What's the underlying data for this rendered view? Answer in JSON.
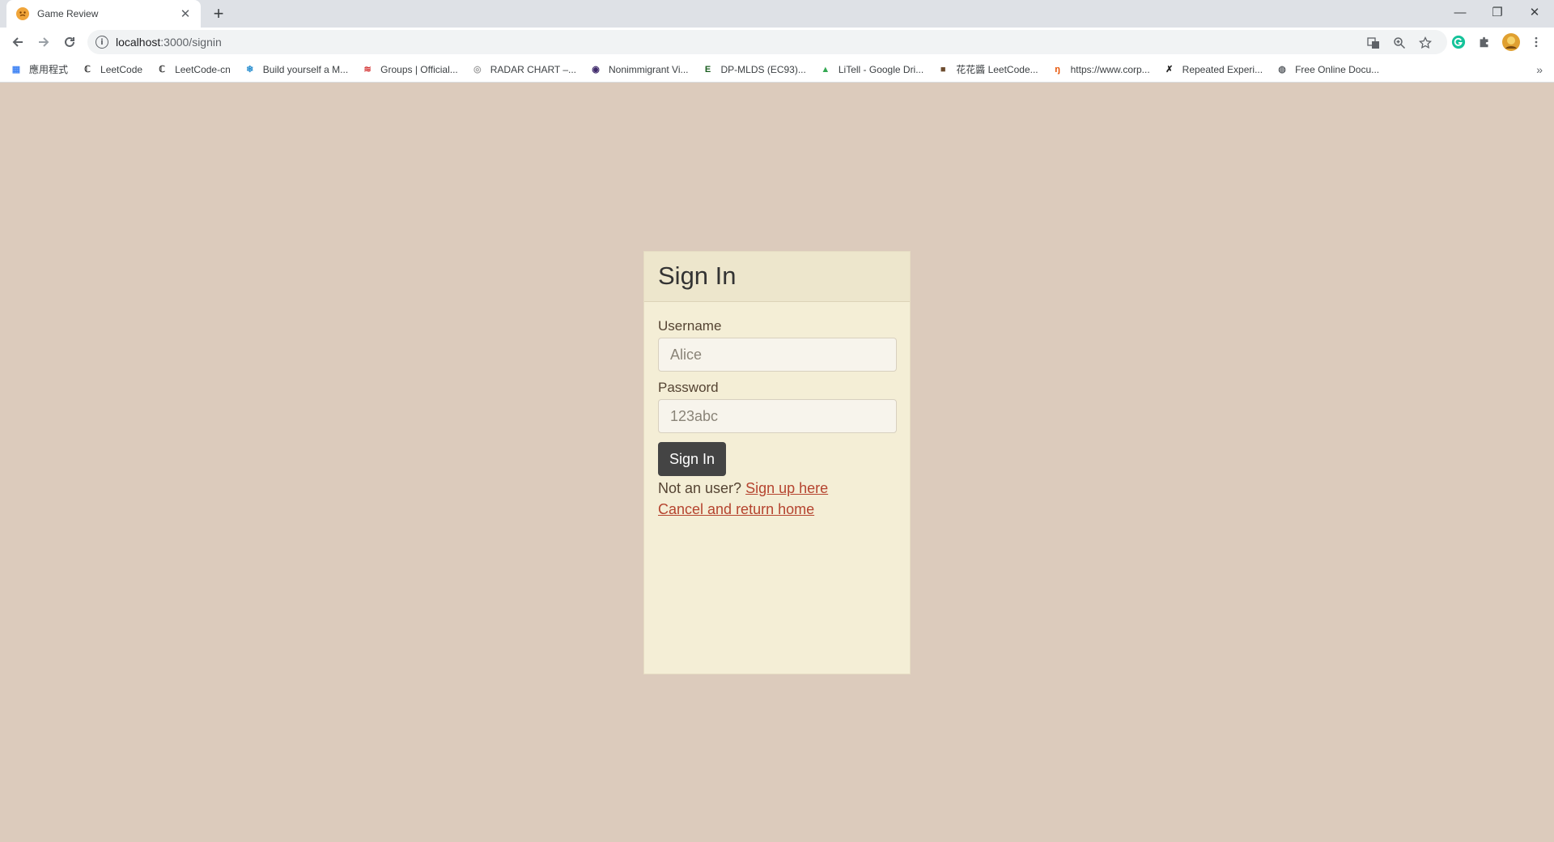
{
  "browser": {
    "tab_title": "Game Review",
    "url_host": "localhost",
    "url_path": ":3000/signin",
    "bookmarks": [
      {
        "label": "應用程式",
        "icon": "apps-grid-icon",
        "color": "#4285f4"
      },
      {
        "label": "LeetCode",
        "icon": "leetcode-icon",
        "color": "#333333"
      },
      {
        "label": "LeetCode-cn",
        "icon": "leetcode-icon",
        "color": "#333333"
      },
      {
        "label": "Build yourself a M...",
        "icon": "snowflake-icon",
        "color": "#2a8fd0"
      },
      {
        "label": "Groups | Official...",
        "icon": "groups-icon",
        "color": "#d32f2f"
      },
      {
        "label": "RADAR CHART –...",
        "icon": "radar-icon",
        "color": "#9e9e9e"
      },
      {
        "label": "Nonimmigrant Vi...",
        "icon": "seal-icon",
        "color": "#3f2a6b"
      },
      {
        "label": "DP-MLDS (EC93)...",
        "icon": "ece-icon",
        "color": "#1a5e20"
      },
      {
        "label": "LiTell - Google Dri...",
        "icon": "google-drive-icon",
        "color": "#34a853"
      },
      {
        "label": "花花醬 LeetCode...",
        "icon": "avatar-icon",
        "color": "#6d4c2f"
      },
      {
        "label": "https://www.corp...",
        "icon": "corp-icon",
        "color": "#e65100"
      },
      {
        "label": "Repeated Experi...",
        "icon": "x-logo-icon",
        "color": "#222222"
      },
      {
        "label": "Free Online Docu...",
        "icon": "globe-icon",
        "color": "#5f6368"
      }
    ]
  },
  "page": {
    "title": "Sign In",
    "username_label": "Username",
    "username_placeholder": "Alice",
    "password_label": "Password",
    "password_placeholder": "123abc",
    "submit_label": "Sign In",
    "not_user_text": "Not an user?",
    "signup_link": "Sign up here",
    "cancel_link": "Cancel and return home"
  },
  "colors": {
    "page_bg": "#dccbbc",
    "card_bg": "#f4eed6",
    "button_bg": "#444444",
    "link": "#b5442f"
  }
}
